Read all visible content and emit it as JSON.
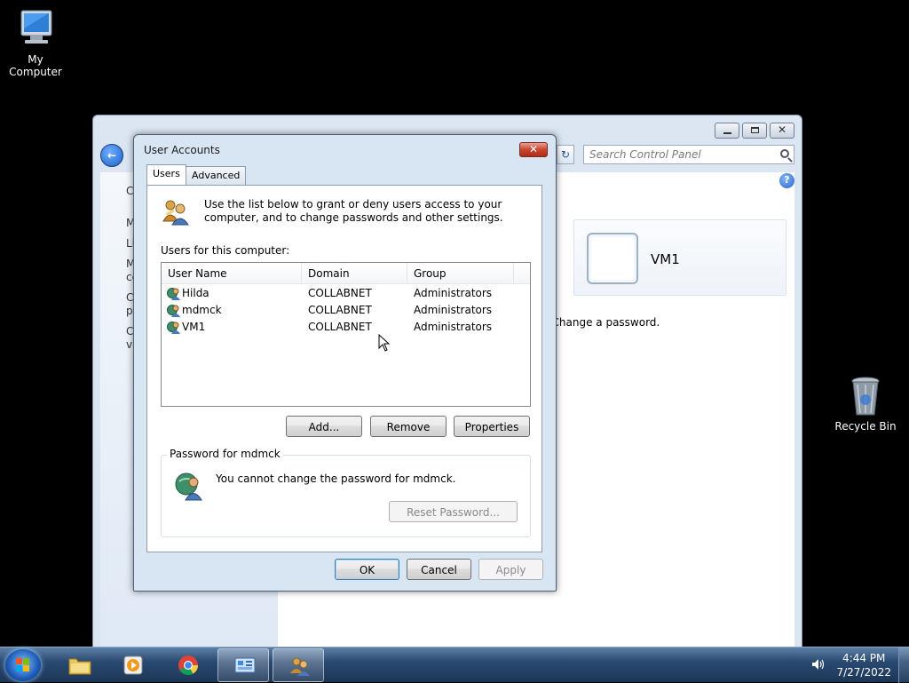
{
  "desktop": {
    "my_computer": "My Computer",
    "recycle_bin": "Recycle Bin"
  },
  "control_panel": {
    "search_placeholder": "Search Control Panel",
    "user_name": "VM1",
    "change_password_text": "t Change a password.",
    "sidebar_fragments": [
      "C",
      "M",
      "Li",
      "M",
      "ce",
      "C",
      "p",
      "C",
      "va"
    ]
  },
  "dialog": {
    "title": "User Accounts",
    "tabs": [
      {
        "label": "Users",
        "active": true
      },
      {
        "label": "Advanced",
        "active": false
      }
    ],
    "intro_text": "Use the list below to grant or deny users access to your computer, and to change passwords and other settings.",
    "users_label": "Users for this computer:",
    "columns": [
      "User Name",
      "Domain",
      "Group"
    ],
    "users": [
      {
        "name": "Hilda",
        "domain": "COLLABNET",
        "group": "Administrators"
      },
      {
        "name": "mdmck",
        "domain": "COLLABNET",
        "group": "Administrators"
      },
      {
        "name": "VM1",
        "domain": "COLLABNET",
        "group": "Administrators"
      }
    ],
    "buttons": {
      "add": "Add...",
      "remove": "Remove",
      "properties": "Properties"
    },
    "password_group": {
      "label": "Password for mdmck",
      "message": "You cannot change the password for mdmck.",
      "reset_button": "Reset Password..."
    },
    "footer": {
      "ok": "OK",
      "cancel": "Cancel",
      "apply": "Apply"
    }
  },
  "taskbar": {
    "time": "4:44 PM",
    "date": "7/27/2022"
  },
  "colors": {
    "close_button": "#c9452f",
    "taskbar": "#2a4a72",
    "dialog_frame": "#d8e5f3"
  }
}
